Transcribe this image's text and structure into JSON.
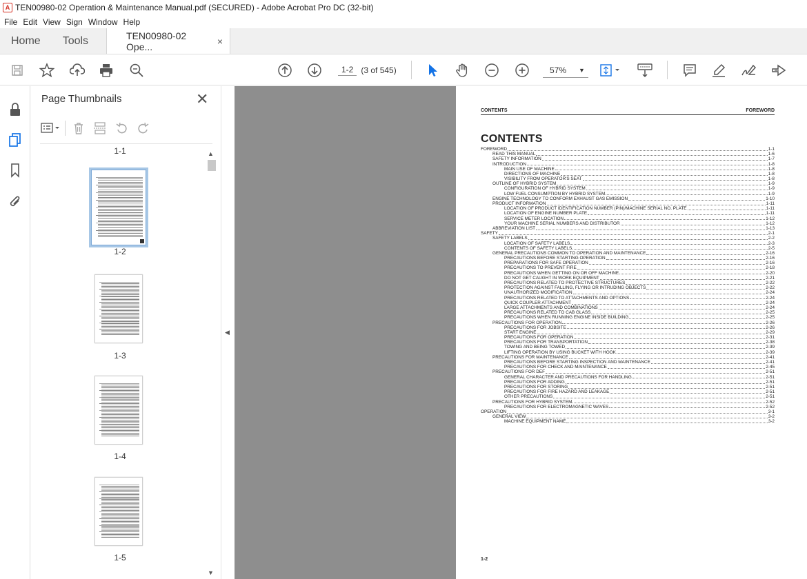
{
  "window": {
    "title": "TEN00980-02 Operation & Maintenance Manual.pdf (SECURED) - Adobe Acrobat Pro DC (32-bit)"
  },
  "menu": [
    "File",
    "Edit",
    "View",
    "Sign",
    "Window",
    "Help"
  ],
  "tabs": {
    "home": "Home",
    "tools": "Tools",
    "doc": "TEN00980-02 Ope...",
    "close": "×"
  },
  "toolbar": {
    "page_current": "1-2",
    "page_total": "(3 of 545)",
    "zoom": "57%",
    "icons": [
      "save-icon",
      "bookmark-star-icon",
      "upload-icon",
      "print-icon",
      "search-zoom-icon",
      "page-up-icon",
      "page-down-icon",
      "pointer-icon",
      "hand-icon",
      "zoom-out-icon",
      "zoom-in-icon",
      "fit-page-icon",
      "scroll-mode-icon",
      "comment-icon",
      "highlight-icon",
      "sign-icon",
      "share-tools-icon"
    ]
  },
  "left_rail": {
    "icons": [
      "lock-icon",
      "page-thumbnails-icon",
      "bookmark-icon",
      "attachment-icon"
    ]
  },
  "panel": {
    "title": "Page Thumbnails",
    "close": "✕",
    "thumbnails": [
      {
        "label": "1-1"
      },
      {
        "label": "1-2",
        "selected": true
      },
      {
        "label": "1-3"
      },
      {
        "label": "1-4"
      },
      {
        "label": "1-5"
      }
    ]
  },
  "document": {
    "header_left": "CONTENTS",
    "header_right": "FOREWORD",
    "title": "CONTENTS",
    "footer": "1-2",
    "toc": [
      {
        "lvl": 0,
        "t": "FOREWORD",
        "p": "1-1"
      },
      {
        "lvl": 1,
        "t": "READ THIS MANUAL",
        "p": "1-6"
      },
      {
        "lvl": 1,
        "t": "SAFETY INFORMATION",
        "p": "1-7"
      },
      {
        "lvl": 1,
        "t": "INTRODUCTION",
        "p": "1-8"
      },
      {
        "lvl": 2,
        "t": "MAIN USE OF MACHINE",
        "p": "1-8"
      },
      {
        "lvl": 2,
        "t": "DIRECTIONS OF MACHINE",
        "p": "1-8"
      },
      {
        "lvl": 2,
        "t": "VISIBILITY FROM OPERATOR'S SEAT",
        "p": "1-8"
      },
      {
        "lvl": 1,
        "t": "OUTLINE OF HYBRID SYSTEM",
        "p": "1-9"
      },
      {
        "lvl": 2,
        "t": "CONFIGURATION OF HYBRID SYSTEM",
        "p": "1-9"
      },
      {
        "lvl": 2,
        "t": "LOW FUEL CONSUMPTION BY HYBRID SYSTEM",
        "p": "1-9"
      },
      {
        "lvl": 1,
        "t": "ENGINE TECHNOLOGY TO CONFORM EXHAUST GAS EMISSION",
        "p": "1-10"
      },
      {
        "lvl": 1,
        "t": "PRODUCT INFORMATION",
        "p": "1-11"
      },
      {
        "lvl": 2,
        "t": "LOCATION OF PRODUCT IDENTIFICATION NUMBER (PIN)/MACHINE SERIAL NO. PLATE",
        "p": "1-11"
      },
      {
        "lvl": 2,
        "t": "LOCATION OF ENGINE NUMBER PLATE",
        "p": "1-11"
      },
      {
        "lvl": 2,
        "t": "SERVICE METER LOCATION",
        "p": "1-12"
      },
      {
        "lvl": 2,
        "t": "YOUR MACHINE SERIAL NUMBERS AND DISTRIBUTOR",
        "p": "1-12"
      },
      {
        "lvl": 1,
        "t": "ABBREVIATION LIST",
        "p": "1-13"
      },
      {
        "lvl": 0,
        "t": "SAFETY",
        "p": "2-1"
      },
      {
        "lvl": 1,
        "t": "SAFETY LABELS",
        "p": "2-2"
      },
      {
        "lvl": 2,
        "t": "LOCATION OF SAFETY LABELS",
        "p": "2-3"
      },
      {
        "lvl": 2,
        "t": "CONTENTS OF SAFETY LABELS",
        "p": "2-5"
      },
      {
        "lvl": 1,
        "t": "GENERAL PRECAUTIONS COMMON TO OPERATION AND MAINTENANCE",
        "p": "2-16"
      },
      {
        "lvl": 2,
        "t": "PRECAUTIONS BEFORE STARTING OPERATION",
        "p": "2-16"
      },
      {
        "lvl": 2,
        "t": "PREPARATIONS FOR SAFE OPERATION",
        "p": "2-16"
      },
      {
        "lvl": 2,
        "t": "PRECAUTIONS TO PREVENT FIRE",
        "p": "2-18"
      },
      {
        "lvl": 2,
        "t": "PRECAUTIONS WHEN GETTING ON OR OFF MACHINE",
        "p": "2-20"
      },
      {
        "lvl": 2,
        "t": "DO NOT GET CAUGHT IN WORK EQUIPMENT",
        "p": "2-21"
      },
      {
        "lvl": 2,
        "t": "PRECAUTIONS RELATED TO PROTECTIVE STRUCTURES",
        "p": "2-22"
      },
      {
        "lvl": 2,
        "t": "PROTECTION AGAINST FALLING, FLYING OR INTRUDING OBJECTS",
        "p": "2-22"
      },
      {
        "lvl": 2,
        "t": "UNAUTHORIZED MODIFICATION",
        "p": "2-24"
      },
      {
        "lvl": 2,
        "t": "PRECAUTIONS RELATED TO ATTACHMENTS AND OPTIONS",
        "p": "2-24"
      },
      {
        "lvl": 2,
        "t": "QUICK COUPLER ATTACHMENT",
        "p": "2-24"
      },
      {
        "lvl": 2,
        "t": "LARGE ATTACHMENTS AND COMBINATIONS",
        "p": "2-24"
      },
      {
        "lvl": 2,
        "t": "PRECAUTIONS RELATED TO CAB GLASS",
        "p": "2-25"
      },
      {
        "lvl": 2,
        "t": "PRECAUTIONS WHEN RUNNING ENGINE INSIDE BUILDING",
        "p": "2-25"
      },
      {
        "lvl": 1,
        "t": "PRECAUTIONS FOR OPERATION",
        "p": "2-26"
      },
      {
        "lvl": 2,
        "t": "PRECAUTIONS FOR JOBSITE",
        "p": "2-26"
      },
      {
        "lvl": 2,
        "t": "START ENGINE",
        "p": "2-29"
      },
      {
        "lvl": 2,
        "t": "PRECAUTIONS FOR OPERATION",
        "p": "2-31"
      },
      {
        "lvl": 2,
        "t": "PRECAUTIONS FOR TRANSPORTATION",
        "p": "2-38"
      },
      {
        "lvl": 2,
        "t": "TOWING AND BEING TOWED",
        "p": "2-39"
      },
      {
        "lvl": 2,
        "t": "LIFTING OPERATION BY USING BUCKET WITH HOOK",
        "p": "2-39"
      },
      {
        "lvl": 1,
        "t": "PRECAUTIONS FOR MAINTENANCE",
        "p": "2-41"
      },
      {
        "lvl": 2,
        "t": "PRECAUTIONS BEFORE STARTING INSPECTION AND MAINTENANCE",
        "p": "2-41"
      },
      {
        "lvl": 2,
        "t": "PRECAUTIONS FOR CHECK AND MAINTENANCE",
        "p": "2-45"
      },
      {
        "lvl": 1,
        "t": "PRECAUTIONS FOR DEF",
        "p": "2-51"
      },
      {
        "lvl": 2,
        "t": "GENERAL CHARACTER AND PRECAUTIONS FOR HANDLING",
        "p": "2-51"
      },
      {
        "lvl": 2,
        "t": "PRECAUTIONS FOR ADDING",
        "p": "2-51"
      },
      {
        "lvl": 2,
        "t": "PRECAUTIONS FOR STORING",
        "p": "2-51"
      },
      {
        "lvl": 2,
        "t": "PRECAUTIONS FOR FIRE HAZARD AND LEAKAGE",
        "p": "2-51"
      },
      {
        "lvl": 2,
        "t": "OTHER PRECAUTIONS",
        "p": "2-51"
      },
      {
        "lvl": 1,
        "t": "PRECAUTIONS FOR HYBRID SYSTEM",
        "p": "2-52"
      },
      {
        "lvl": 2,
        "t": "PRECAUTIONS FOR ELECTROMAGNETIC WAVES",
        "p": "2-52"
      },
      {
        "lvl": 0,
        "t": "OPERATION",
        "p": "3-1"
      },
      {
        "lvl": 1,
        "t": "GENERAL VIEW",
        "p": "3-2"
      },
      {
        "lvl": 2,
        "t": "MACHINE EQUIPMENT NAME",
        "p": "3-2"
      }
    ]
  }
}
